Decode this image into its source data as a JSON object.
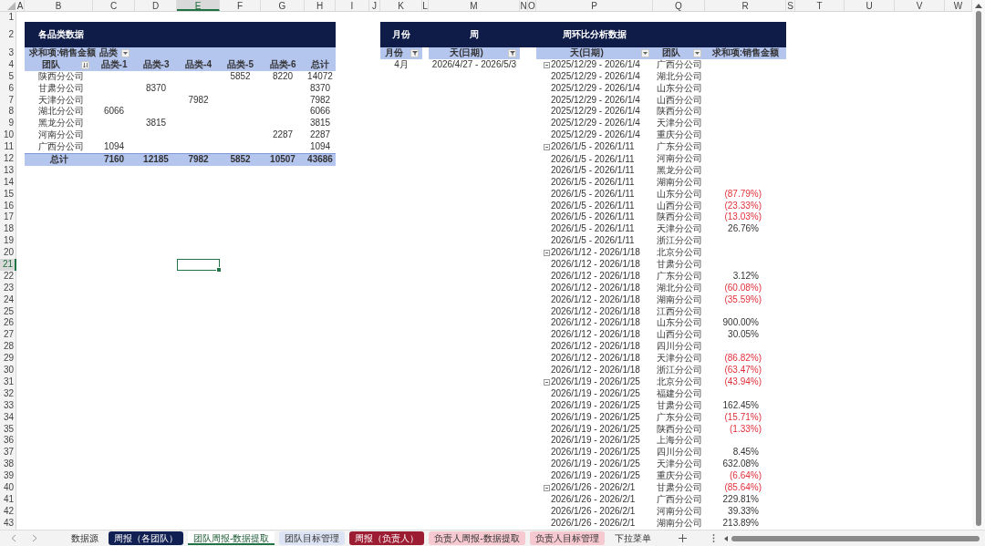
{
  "column_headers": [
    {
      "label": "A",
      "selected": false
    },
    {
      "label": "B",
      "selected": false
    },
    {
      "label": "C",
      "selected": false
    },
    {
      "label": "D",
      "selected": false
    },
    {
      "label": "E",
      "selected": true
    },
    {
      "label": "F",
      "selected": false
    },
    {
      "label": "G",
      "selected": false
    },
    {
      "label": "H",
      "selected": false
    },
    {
      "label": "I",
      "selected": false
    },
    {
      "label": "J",
      "selected": false
    },
    {
      "label": "K",
      "selected": false
    },
    {
      "label": "L",
      "selected": false
    },
    {
      "label": "M",
      "selected": false
    },
    {
      "label": "N",
      "selected": false
    },
    {
      "label": "O",
      "selected": false
    },
    {
      "label": "P",
      "selected": false
    },
    {
      "label": "Q",
      "selected": false
    },
    {
      "label": "R",
      "selected": false
    },
    {
      "label": "S",
      "selected": false
    },
    {
      "label": "T",
      "selected": false
    },
    {
      "label": "U",
      "selected": false
    },
    {
      "label": "V",
      "selected": false
    },
    {
      "label": "W",
      "selected": false
    }
  ],
  "row_headers": [
    {
      "label": "1",
      "selected": false
    },
    {
      "label": "2",
      "selected": false
    },
    {
      "label": "3",
      "selected": false
    },
    {
      "label": "4",
      "selected": false
    },
    {
      "label": "5",
      "selected": false
    },
    {
      "label": "6",
      "selected": false
    },
    {
      "label": "7",
      "selected": false
    },
    {
      "label": "8",
      "selected": false
    },
    {
      "label": "9",
      "selected": false
    },
    {
      "label": "10",
      "selected": false
    },
    {
      "label": "11",
      "selected": false
    },
    {
      "label": "12",
      "selected": false
    },
    {
      "label": "13",
      "selected": false
    },
    {
      "label": "14",
      "selected": false
    },
    {
      "label": "15",
      "selected": false
    },
    {
      "label": "16",
      "selected": false
    },
    {
      "label": "17",
      "selected": false
    },
    {
      "label": "18",
      "selected": false
    },
    {
      "label": "19",
      "selected": false
    },
    {
      "label": "20",
      "selected": false
    },
    {
      "label": "21",
      "selected": true
    },
    {
      "label": "22",
      "selected": false
    },
    {
      "label": "23",
      "selected": false
    },
    {
      "label": "24",
      "selected": false
    },
    {
      "label": "25",
      "selected": false
    },
    {
      "label": "26",
      "selected": false
    },
    {
      "label": "27",
      "selected": false
    },
    {
      "label": "28",
      "selected": false
    },
    {
      "label": "29",
      "selected": false
    },
    {
      "label": "30",
      "selected": false
    },
    {
      "label": "31",
      "selected": false
    },
    {
      "label": "32",
      "selected": false
    },
    {
      "label": "33",
      "selected": false
    },
    {
      "label": "34",
      "selected": false
    },
    {
      "label": "35",
      "selected": false
    },
    {
      "label": "36",
      "selected": false
    },
    {
      "label": "37",
      "selected": false
    },
    {
      "label": "38",
      "selected": false
    },
    {
      "label": "39",
      "selected": false
    },
    {
      "label": "40",
      "selected": false
    },
    {
      "label": "41",
      "selected": false
    },
    {
      "label": "42",
      "selected": false
    },
    {
      "label": "43",
      "selected": false
    }
  ],
  "category_section": {
    "title": "各品类数据"
  },
  "weekly_section": {
    "month_title": "月份",
    "week_title": "周",
    "analysis_title": "周环比分析数据"
  },
  "category_pivot": {
    "value_field": "求和项:销售金额",
    "column_field": "品类",
    "row_field": "团队",
    "columns": [
      "品类-1",
      "品类-3",
      "品类-4",
      "品类-5",
      "品类-6",
      "总计"
    ],
    "rows": [
      {
        "team": "陕西分公司",
        "cells": [
          {},
          {},
          {},
          {
            "value": "5852"
          },
          {
            "value": "8220"
          },
          {
            "value": "14072"
          }
        ]
      },
      {
        "team": "甘肃分公司",
        "cells": [
          {},
          {
            "value": "8370"
          },
          {},
          {},
          {},
          {
            "value": "8370"
          }
        ]
      },
      {
        "team": "天津分公司",
        "cells": [
          {},
          {},
          {
            "value": "7982"
          },
          {},
          {},
          {
            "value": "7982"
          }
        ]
      },
      {
        "team": "湖北分公司",
        "cells": [
          {
            "value": "6066"
          },
          {},
          {},
          {},
          {},
          {
            "value": "6066"
          }
        ]
      },
      {
        "team": "黑龙分公司",
        "cells": [
          {},
          {
            "value": "3815"
          },
          {},
          {},
          {},
          {
            "value": "3815"
          }
        ]
      },
      {
        "team": "河南分公司",
        "cells": [
          {},
          {},
          {},
          {},
          {
            "value": "2287"
          },
          {
            "value": "2287"
          }
        ]
      },
      {
        "team": "广西分公司",
        "cells": [
          {
            "value": "1094"
          },
          {},
          {},
          {},
          {},
          {
            "value": "1094"
          }
        ]
      }
    ],
    "total": {
      "label": "总计",
      "values": [
        "7160",
        "12185",
        "7982",
        "5852",
        "10507",
        "43686"
      ]
    }
  },
  "month_filter": {
    "header": "月份",
    "value": "4月"
  },
  "week_filter": {
    "header": "天(日期)",
    "value": "2026/4/27 - 2026/5/3"
  },
  "weekly_pivot": {
    "columns": [
      "天(日期)",
      "团队",
      "求和项:销售金额"
    ],
    "rows": [
      {
        "date": "2025/12/29 - 2026/1/4",
        "team": "广西分公司",
        "group_start": true
      },
      {
        "date": "2025/12/29 - 2026/1/4",
        "team": "湖北分公司",
        "group_start": false
      },
      {
        "date": "2025/12/29 - 2026/1/4",
        "team": "山东分公司",
        "group_start": false
      },
      {
        "date": "2025/12/29 - 2026/1/4",
        "team": "山西分公司",
        "group_start": false
      },
      {
        "date": "2025/12/29 - 2026/1/4",
        "team": "陕西分公司",
        "group_start": false
      },
      {
        "date": "2025/12/29 - 2026/1/4",
        "team": "天津分公司",
        "group_start": false
      },
      {
        "date": "2025/12/29 - 2026/1/4",
        "team": "重庆分公司",
        "group_start": false
      },
      {
        "date": "2026/1/5 - 2026/1/11",
        "team": "广东分公司",
        "group_start": true
      },
      {
        "date": "2026/1/5 - 2026/1/11",
        "team": "河南分公司",
        "group_start": false
      },
      {
        "date": "2026/1/5 - 2026/1/11",
        "team": "黑龙分公司",
        "group_start": false
      },
      {
        "date": "2026/1/5 - 2026/1/11",
        "team": "湖南分公司",
        "group_start": false
      },
      {
        "date": "2026/1/5 - 2026/1/11",
        "team": "山东分公司",
        "group_start": false,
        "value": "(87.79%)",
        "negative": true
      },
      {
        "date": "2026/1/5 - 2026/1/11",
        "team": "山西分公司",
        "group_start": false,
        "value": "(23.33%)",
        "negative": true
      },
      {
        "date": "2026/1/5 - 2026/1/11",
        "team": "陕西分公司",
        "group_start": false,
        "value": "(13.03%)",
        "negative": true
      },
      {
        "date": "2026/1/5 - 2026/1/11",
        "team": "天津分公司",
        "group_start": false,
        "value": "26.76%",
        "negative": false
      },
      {
        "date": "2026/1/5 - 2026/1/11",
        "team": "浙江分公司",
        "group_start": false
      },
      {
        "date": "2026/1/12 - 2026/1/18",
        "team": "北京分公司",
        "group_start": true
      },
      {
        "date": "2026/1/12 - 2026/1/18",
        "team": "甘肃分公司",
        "group_start": false
      },
      {
        "date": "2026/1/12 - 2026/1/18",
        "team": "广东分公司",
        "group_start": false,
        "value": "3.12%",
        "negative": false
      },
      {
        "date": "2026/1/12 - 2026/1/18",
        "team": "湖北分公司",
        "group_start": false,
        "value": "(60.08%)",
        "negative": true
      },
      {
        "date": "2026/1/12 - 2026/1/18",
        "team": "湖南分公司",
        "group_start": false,
        "value": "(35.59%)",
        "negative": true
      },
      {
        "date": "2026/1/12 - 2026/1/18",
        "team": "江西分公司",
        "group_start": false
      },
      {
        "date": "2026/1/12 - 2026/1/18",
        "team": "山东分公司",
        "group_start": false,
        "value": "900.00%",
        "negative": false
      },
      {
        "date": "2026/1/12 - 2026/1/18",
        "team": "山西分公司",
        "group_start": false,
        "value": "30.05%",
        "negative": false
      },
      {
        "date": "2026/1/12 - 2026/1/18",
        "team": "四川分公司",
        "group_start": false
      },
      {
        "date": "2026/1/12 - 2026/1/18",
        "team": "天津分公司",
        "group_start": false,
        "value": "(86.82%)",
        "negative": true
      },
      {
        "date": "2026/1/12 - 2026/1/18",
        "team": "浙江分公司",
        "group_start": false,
        "value": "(63.47%)",
        "negative": true
      },
      {
        "date": "2026/1/19 - 2026/1/25",
        "team": "北京分公司",
        "group_start": true,
        "value": "(43.94%)",
        "negative": true
      },
      {
        "date": "2026/1/19 - 2026/1/25",
        "team": "福建分公司",
        "group_start": false
      },
      {
        "date": "2026/1/19 - 2026/1/25",
        "team": "甘肃分公司",
        "group_start": false,
        "value": "162.45%",
        "negative": false
      },
      {
        "date": "2026/1/19 - 2026/1/25",
        "team": "广东分公司",
        "group_start": false,
        "value": "(15.71%)",
        "negative": true
      },
      {
        "date": "2026/1/19 - 2026/1/25",
        "team": "陕西分公司",
        "group_start": false,
        "value": "(1.33%)",
        "negative": true
      },
      {
        "date": "2026/1/19 - 2026/1/25",
        "team": "上海分公司",
        "group_start": false
      },
      {
        "date": "2026/1/19 - 2026/1/25",
        "team": "四川分公司",
        "group_start": false,
        "value": "8.45%",
        "negative": false
      },
      {
        "date": "2026/1/19 - 2026/1/25",
        "team": "天津分公司",
        "group_start": false,
        "value": "632.08%",
        "negative": false
      },
      {
        "date": "2026/1/19 - 2026/1/25",
        "team": "重庆分公司",
        "group_start": false,
        "value": "(6.64%)",
        "negative": true
      },
      {
        "date": "2026/1/26 - 2026/2/1",
        "team": "甘肃分公司",
        "group_start": true,
        "value": "(85.64%)",
        "negative": true
      },
      {
        "date": "2026/1/26 - 2026/2/1",
        "team": "广西分公司",
        "group_start": false,
        "value": "229.81%",
        "negative": false
      },
      {
        "date": "2026/1/26 - 2026/2/1",
        "team": "河南分公司",
        "group_start": false,
        "value": "39.33%",
        "negative": false
      },
      {
        "date": "2026/1/26 - 2026/2/1",
        "team": "湖南分公司",
        "group_start": false,
        "value": "213.89%",
        "negative": false
      }
    ]
  },
  "tabs": [
    {
      "label": "数据源",
      "selected": false
    },
    {
      "label": "周报（各团队）",
      "selected": false,
      "color": "#102052"
    },
    {
      "label": "团队周报-数据提取",
      "selected": true
    },
    {
      "label": "团队目标管理",
      "selected": false,
      "color": "#dce4f4"
    },
    {
      "label": "周报（负责人）",
      "selected": false,
      "color": "#9c1c32"
    },
    {
      "label": "负责人周报-数据提取",
      "selected": false,
      "color": "#f5c9cf"
    },
    {
      "label": "负责人目标管理",
      "selected": false,
      "color": "#f5c9cf"
    },
    {
      "label": "下拉菜单",
      "selected": false
    }
  ]
}
